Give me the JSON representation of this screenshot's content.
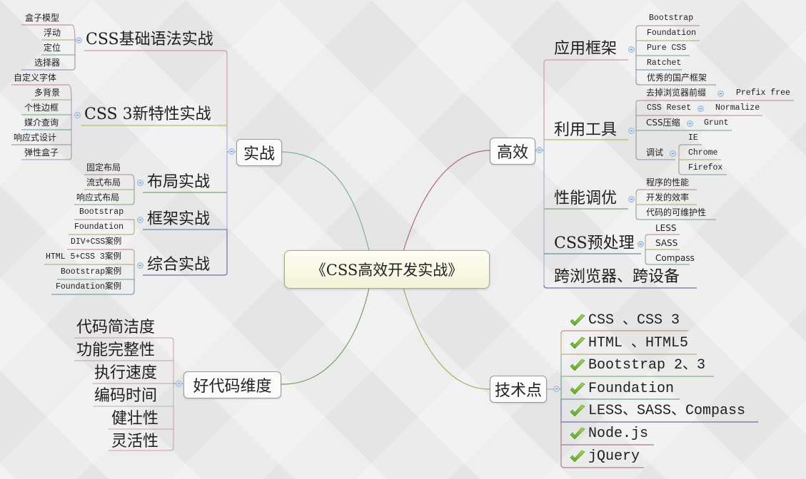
{
  "root": {
    "label": "《CSS高效开发实战》"
  },
  "colors": {
    "background": "#ebebeb",
    "root_fill": "#f7f7e2",
    "wire_shizhan": "#7fb0a8",
    "wire_gaoxiao": "#b06a70",
    "wire_haodaima": "#7a9e6a",
    "wire_jishudian": "#a8a872",
    "check_icon": "#7cc13a",
    "collapse_icon": "#cfe0f3"
  },
  "branches": {
    "shizhan": {
      "label": "实战",
      "children": [
        {
          "label": "CSS基础语法实战",
          "children": [
            "盒子模型",
            "浮动",
            "定位",
            "选择器"
          ]
        },
        {
          "label": "CSS 3新特性实战",
          "children": [
            "自定义字体",
            "多背景",
            "个性边框",
            "媒介查询",
            "响应式设计",
            "弹性盒子"
          ]
        },
        {
          "label": "布局实战",
          "children": [
            "固定布局",
            "流式布局",
            "响应式布局"
          ]
        },
        {
          "label": "框架实战",
          "children": [
            "Bootstrap",
            "Foundation"
          ]
        },
        {
          "label": "综合实战",
          "children": [
            "DIV+CSS案例",
            "HTML 5+CSS 3案例",
            "Bootstrap案例",
            "Foundation案例"
          ]
        }
      ]
    },
    "haodaima": {
      "label": "好代码维度",
      "children": [
        "代码简洁度",
        "功能完整性",
        "执行速度",
        "编码时间",
        "健壮性",
        "灵活性"
      ]
    },
    "gaoxiao": {
      "label": "高效",
      "children": [
        {
          "label": "应用框架",
          "children": [
            "Bootstrap",
            "Foundation",
            "Pure CSS",
            "Ratchet",
            "优秀的国产框架"
          ]
        },
        {
          "label": "利用工具",
          "children": [
            {
              "label": "去掉浏览器前缀",
              "child": "Prefix free"
            },
            {
              "label": "CSS Reset",
              "child": "Normalize"
            },
            {
              "label": "CSS压缩",
              "child": "Grunt"
            },
            {
              "label": "调试",
              "children": [
                "IE",
                "Chrome",
                "Firefox"
              ]
            }
          ]
        },
        {
          "label": "性能调优",
          "children": [
            "程序的性能",
            "开发的效率",
            "代码的可维护性"
          ]
        },
        {
          "label": "CSS预处理",
          "children": [
            "LESS",
            "SASS",
            "Compass"
          ]
        },
        {
          "label": "跨浏览器、跨设备",
          "children": []
        }
      ]
    },
    "jishudian": {
      "label": "技术点",
      "icon": "check-icon",
      "children": [
        "CSS 、CSS 3",
        "HTML 、HTML5",
        "Bootstrap 2、3",
        "Foundation",
        "LESS、SASS、Compass",
        "Node.js",
        "jQuery"
      ]
    }
  }
}
